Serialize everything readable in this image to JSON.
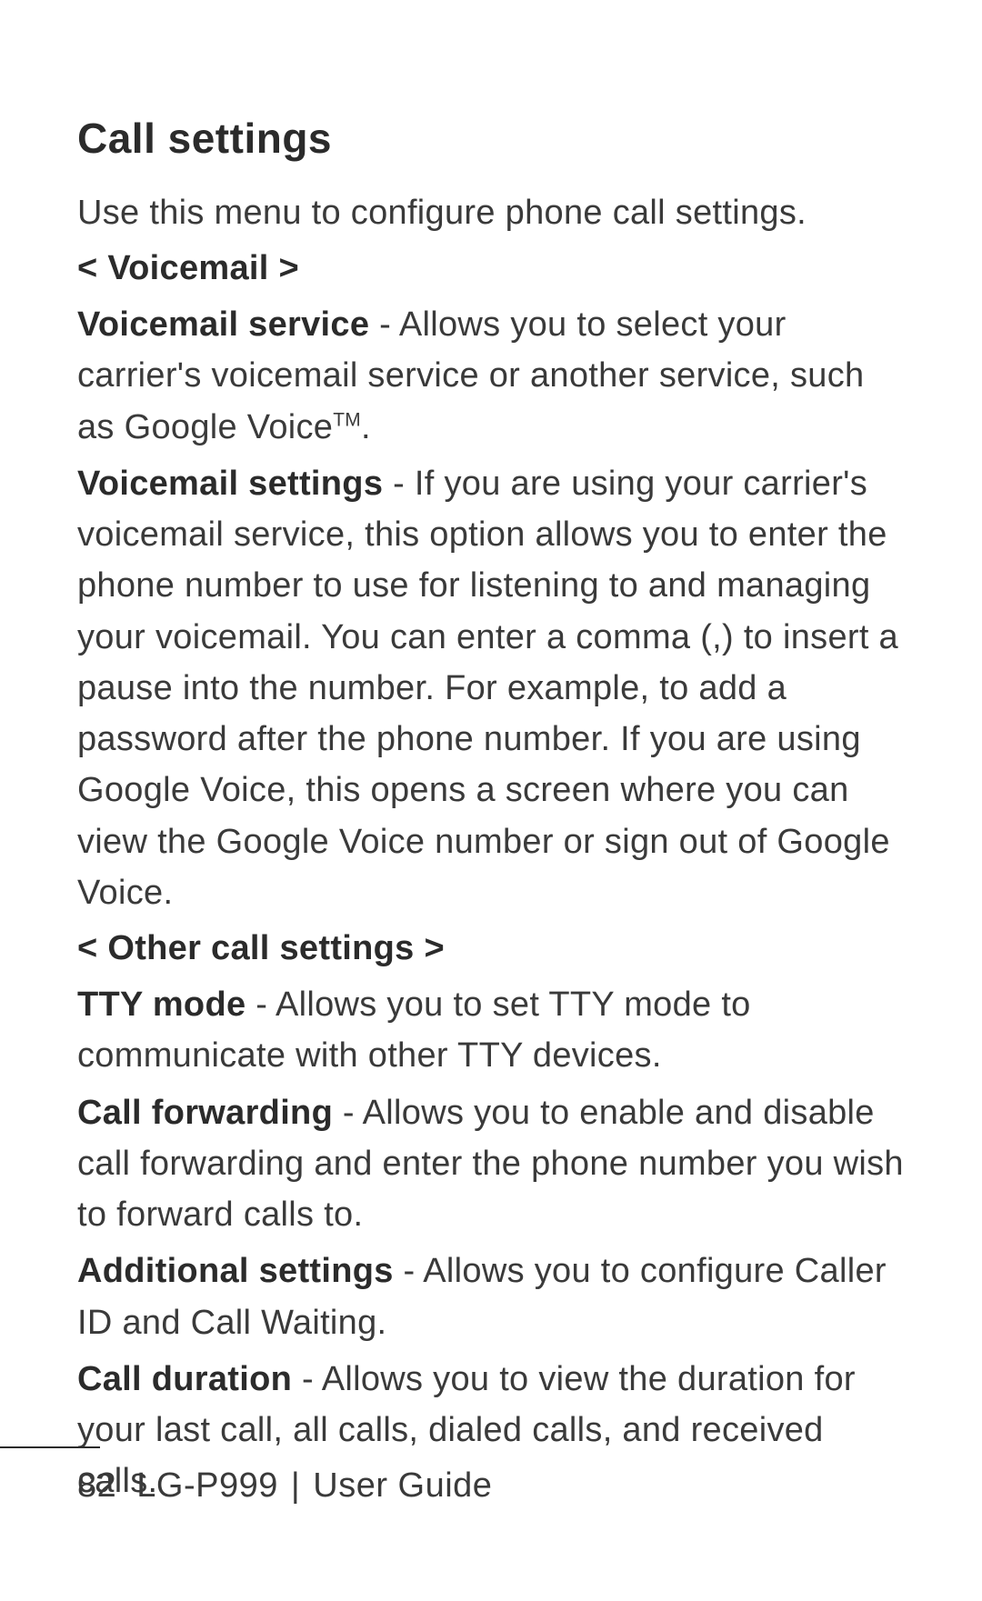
{
  "title": "Call settings",
  "intro": "Use this menu to configure phone call settings.",
  "sections": [
    {
      "header": "< Voicemail >",
      "items": [
        {
          "lead": "Voicemail service",
          "body": " - Allows you to select your carrier's voicemail service or another service, such as Google Voice",
          "trademark": "TM",
          "tail": "."
        },
        {
          "lead": "Voicemail settings",
          "body": " - If you are using your carrier's voicemail service, this option allows you to enter the phone number to use for listening to and managing your voicemail. You can enter a comma (,) to insert a pause into the number. For example, to add a password after the phone number. If you are using Google Voice, this opens a screen where you can view the Google Voice number or sign out of Google Voice."
        }
      ]
    },
    {
      "header": "< Other call settings >",
      "items": [
        {
          "lead": "TTY mode",
          "body": " - Allows you to set TTY mode to communicate with other TTY devices."
        },
        {
          "lead": "Call forwarding",
          "body": " - Allows you to enable and disable call forwarding and enter the phone number you wish to forward calls to."
        },
        {
          "lead": "Additional settings",
          "body": " - Allows you to configure Caller ID and Call Waiting."
        },
        {
          "lead": "Call duration",
          "body": " - Allows you to view the duration for your last call, all calls, dialed calls, and received calls."
        }
      ]
    }
  ],
  "footer": {
    "page_number": "82",
    "model": "LG-P999",
    "separator": "|",
    "doc_title": "User Guide"
  }
}
